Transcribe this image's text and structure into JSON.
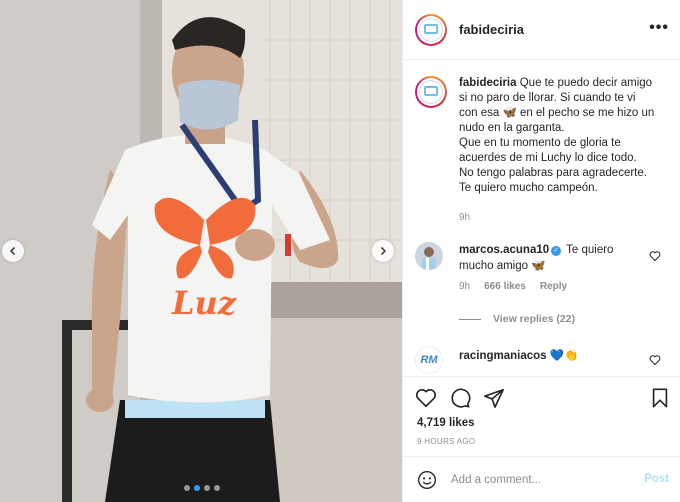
{
  "post": {
    "username": "fabideciria",
    "more_icon": "more-horizontal-icon",
    "caption": {
      "username": "fabideciria",
      "line1": "Que te puedo decir amigo",
      "line2": "si no paro de llorar. Si cuando te vi",
      "line3a": "con esa",
      "line3_emoji": "🦋",
      "line3b": "en el pecho se me hizo un",
      "line4": "nudo en la garganta.",
      "line5": "Que en tu momento de gloria te",
      "line6": "acuerdes de mi Luchy lo dice todo.",
      "line7": "No tengo palabras para agradecerte.",
      "line8": "Te quiero mucho campeón.",
      "time": "9h"
    },
    "comments": [
      {
        "username": "marcos.acuna10",
        "verified_icon": "verified-check-icon",
        "text_a": "Te quiero",
        "text_b": "mucho amigo",
        "emoji": "🦋",
        "time": "9h",
        "likes": "666 likes",
        "reply": "Reply",
        "view_replies": "View replies (22)"
      },
      {
        "username": "racingmaniacos",
        "emoji": "💙👏",
        "avatar_text": "RM"
      }
    ],
    "likes": "4,719 likes",
    "ago": "9 HOURS AGO",
    "add_comment_placeholder": "Add a comment...",
    "post_label": "Post",
    "shirt_text": "Luz",
    "carousel_dots": 4,
    "carousel_active": 1
  },
  "colors": {
    "accent": "#3897f0",
    "post_disabled": "#b2dffc",
    "butterfly": "#f26b3a"
  }
}
